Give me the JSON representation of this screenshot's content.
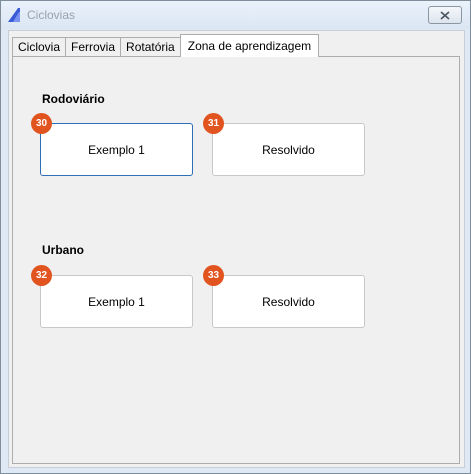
{
  "window": {
    "title": "Ciclovias"
  },
  "tabs": [
    {
      "label": "Ciclovia"
    },
    {
      "label": "Ferrovia"
    },
    {
      "label": "Rotatória"
    },
    {
      "label": "Zona de aprendizagem"
    }
  ],
  "sections": [
    {
      "title": "Rodoviário",
      "cards": [
        {
          "badge": "30",
          "label": "Exemplo 1"
        },
        {
          "badge": "31",
          "label": "Resolvido"
        }
      ]
    },
    {
      "title": "Urbano",
      "cards": [
        {
          "badge": "32",
          "label": "Exemplo 1"
        },
        {
          "badge": "33",
          "label": "Resolvido"
        }
      ]
    }
  ],
  "colors": {
    "badge": "#e2541f",
    "focus": "#2f6fb8"
  },
  "icons": {
    "app": "app-logo-icon",
    "close": "close-icon"
  }
}
